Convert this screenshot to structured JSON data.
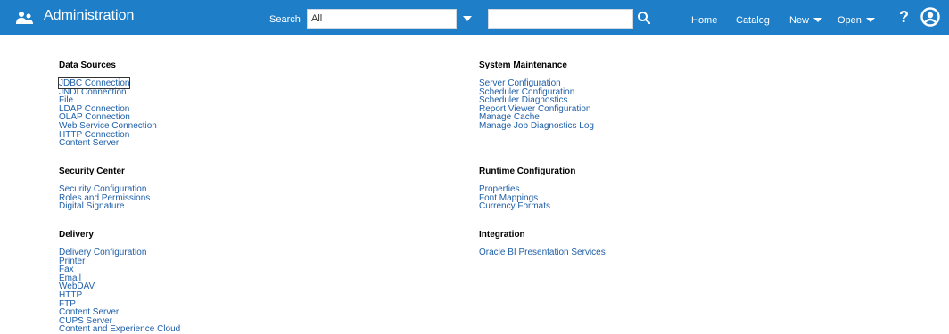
{
  "header": {
    "title": "Administration",
    "brand_icon": "admin-people-icon",
    "search_label": "Search",
    "search_scope": "All",
    "search_value": "",
    "search_icon": "search-icon",
    "nav": {
      "home": "Home",
      "catalog": "Catalog",
      "new": "New",
      "open": "Open",
      "help": "?"
    },
    "user_icon": "user-icon"
  },
  "sections": {
    "data_sources": {
      "title": "Data Sources",
      "links": [
        "JDBC Connection",
        "JNDI Connection",
        "File",
        "LDAP Connection",
        "OLAP Connection",
        "Web Service Connection",
        "HTTP Connection",
        "Content Server"
      ]
    },
    "security_center": {
      "title": "Security Center",
      "links": [
        "Security Configuration",
        "Roles and Permissions",
        "Digital Signature"
      ]
    },
    "delivery": {
      "title": "Delivery",
      "links": [
        "Delivery Configuration",
        "Printer",
        "Fax",
        "Email",
        "WebDAV",
        "HTTP",
        "FTP",
        "Content Server",
        "CUPS Server",
        "Content and Experience Cloud"
      ]
    },
    "system_maintenance": {
      "title": "System Maintenance",
      "links": [
        "Server Configuration",
        "Scheduler Configuration",
        "Scheduler Diagnostics",
        "Report Viewer Configuration",
        "Manage Cache",
        "Manage Job Diagnostics Log"
      ]
    },
    "runtime_configuration": {
      "title": "Runtime Configuration",
      "links": [
        "Properties",
        "Font Mappings",
        "Currency Formats"
      ]
    },
    "integration": {
      "title": "Integration",
      "links": [
        "Oracle BI Presentation Services"
      ]
    }
  },
  "colors": {
    "header_bg": "#1e7ec8",
    "link": "#1f5fa8"
  }
}
